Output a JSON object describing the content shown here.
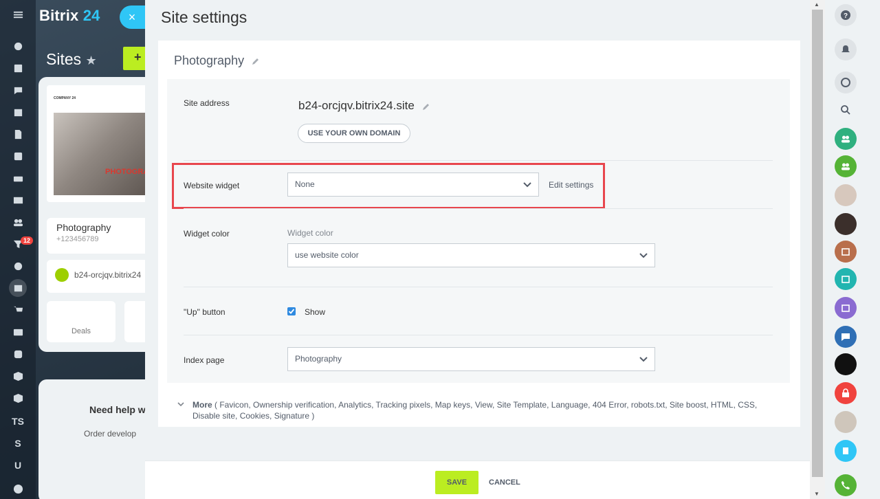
{
  "app": {
    "logo_text": "Bitrix",
    "logo_num": "24",
    "close_glyph": "×"
  },
  "background": {
    "page_title": "Sites",
    "add_glyph": "+",
    "card": {
      "brand": "COMPANY 24",
      "photo_text": "PHOTOGRA",
      "name": "Photography",
      "phone": "+123456789",
      "link": "b24-orcjqv.bitrix24",
      "deals_label": "Deals"
    },
    "help": {
      "title": "Need help w",
      "text": "Order develop"
    },
    "rail_badge": "12",
    "rail_text_items": [
      "TS",
      "S",
      "U"
    ]
  },
  "panel": {
    "title": "Site settings",
    "site_name": "Photography",
    "site_address_label": "Site address",
    "site_address": "b24-orcjqv.bitrix24.site",
    "own_domain_button": "USE YOUR OWN DOMAIN",
    "website_widget_label": "Website widget",
    "website_widget_value": "None",
    "edit_settings": "Edit settings",
    "widget_color_label": "Widget color",
    "widget_color_sublabel": "Widget color",
    "widget_color_value": "use website color",
    "up_button_label": "\"Up\" button",
    "up_button_check": "Show",
    "index_page_label": "Index page",
    "index_page_value": "Photography",
    "more_label": "More",
    "more_items": "( Favicon,  Ownership verification,  Analytics,  Tracking pixels,  Map keys,  View,  Site Template,  Language,  404 Error,  robots.txt,  Site boost,  HTML,  CSS,  Disable site,  Cookies,  Signature )",
    "save_label": "SAVE",
    "cancel_label": "CANCEL"
  },
  "colors": {
    "accent_green": "#bbed21",
    "accent_blue": "#2fc6f6",
    "highlight_red": "#e8464d"
  }
}
